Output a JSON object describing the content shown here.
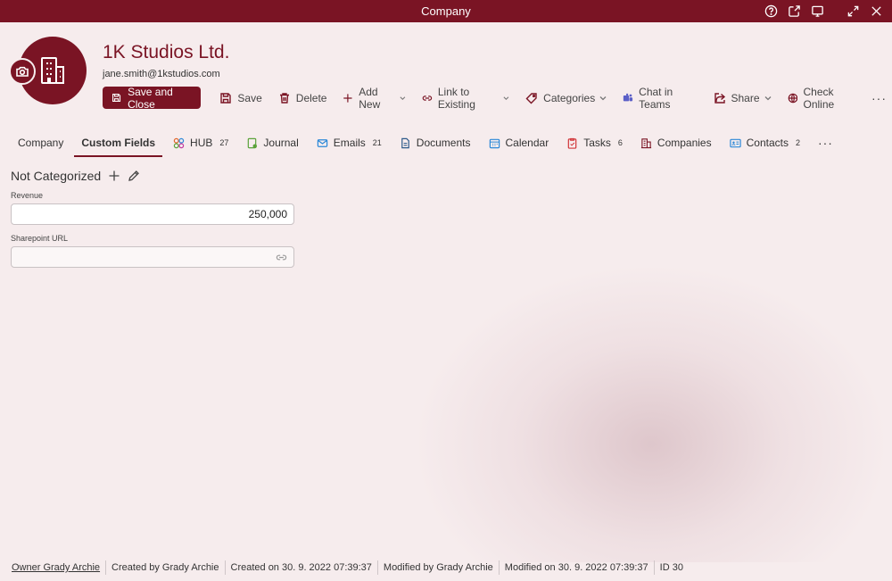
{
  "window": {
    "title": "Company"
  },
  "header": {
    "name": "1K Studios Ltd.",
    "email": "jane.smith@1kstudios.com"
  },
  "toolbar": {
    "save_close": "Save and Close",
    "save": "Save",
    "delete": "Delete",
    "add_new": "Add New",
    "link_existing": "Link to Existing",
    "categories": "Categories",
    "chat_teams": "Chat in Teams",
    "share": "Share",
    "check_online": "Check Online"
  },
  "tabs": [
    {
      "label": "Company",
      "badge": ""
    },
    {
      "label": "Custom Fields",
      "badge": ""
    },
    {
      "label": "HUB",
      "badge": "27"
    },
    {
      "label": "Journal",
      "badge": ""
    },
    {
      "label": "Emails",
      "badge": "21"
    },
    {
      "label": "Documents",
      "badge": ""
    },
    {
      "label": "Calendar",
      "badge": ""
    },
    {
      "label": "Tasks",
      "badge": "6"
    },
    {
      "label": "Companies",
      "badge": ""
    },
    {
      "label": "Contacts",
      "badge": "2"
    }
  ],
  "section": {
    "title": "Not Categorized"
  },
  "fields": {
    "revenue": {
      "label": "Revenue",
      "value": "250,000"
    },
    "sharepoint": {
      "label": "Sharepoint URL",
      "value": ""
    }
  },
  "status": {
    "owner": "Owner Grady Archie",
    "created_by": "Created by Grady Archie",
    "created_on": "Created on 30. 9. 2022 07:39:37",
    "modified_by": "Modified by Grady Archie",
    "modified_on": "Modified on 30. 9. 2022 07:39:37",
    "id": "ID 30"
  },
  "colors": {
    "accent": "#7a1424",
    "background": "#f6eced",
    "teams": "#5b5fc7"
  }
}
